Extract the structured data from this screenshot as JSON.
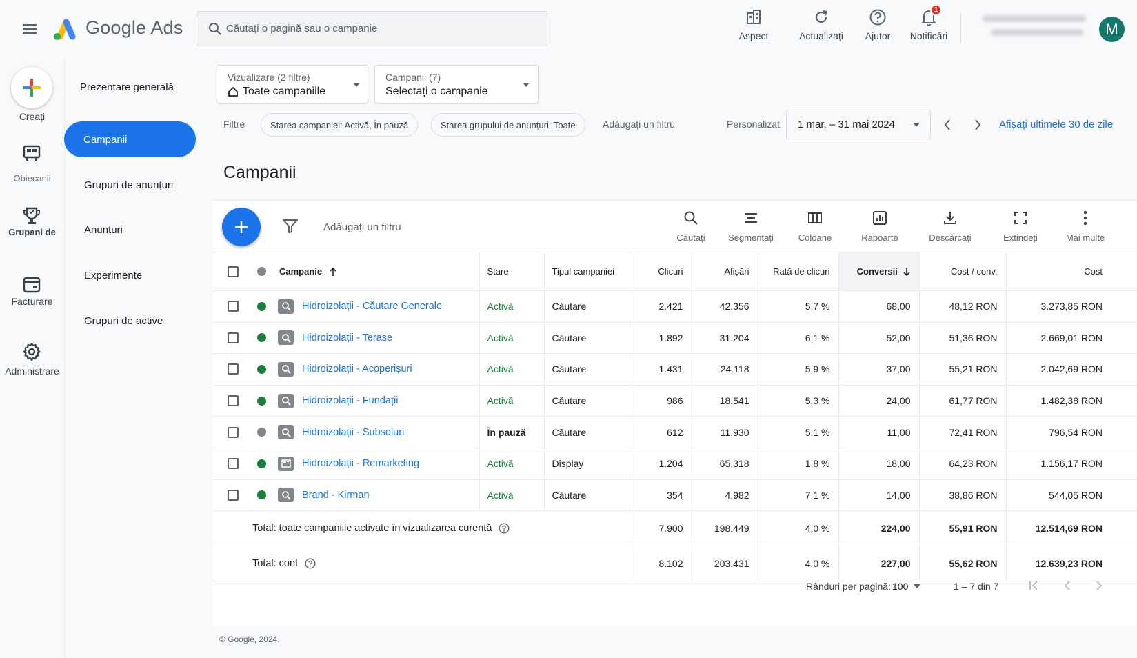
{
  "app": {
    "name": "Google Ads",
    "brand_colors": {
      "blue": "#4285F4",
      "yellow": "#FBBC04",
      "green": "#34A853",
      "red": "#EA4335"
    }
  },
  "search": {
    "placeholder": "Căutați o pagină sau o campanie"
  },
  "topbar": {
    "aspect": "Aspect",
    "refresh": "Actualizați",
    "help": "Ajutor",
    "notifications": "Notificări",
    "notifications_count": "1",
    "avatar_letter": "M"
  },
  "rail": {
    "create": "Creați",
    "goals": "Obiecanii",
    "groups": "Grupani de",
    "billing": "Facturare",
    "admin": "Administrare"
  },
  "nav": {
    "overview": "Prezentare generală",
    "campaigns": "Campanii",
    "ad_groups": "Grupuri de anunțuri",
    "ads": "Anunțuri",
    "experiments": "Experimente",
    "asset_groups": "Grupuri de active"
  },
  "view_dropdown": {
    "label": "Vizualizare (2 filtre)",
    "value": "Toate campaniile"
  },
  "campaign_dropdown": {
    "label": "Campanii (7)",
    "value": "Selectați o campanie"
  },
  "filters": {
    "label": "Filtre",
    "chip1": "Starea campaniei: Activă, În pauză",
    "chip2": "Starea grupului de anunțuri: Toate",
    "add": "Adăugați un filtru"
  },
  "date": {
    "preset": "Personalizat",
    "range": "1 mar. – 31 mai 2024",
    "last30": "Afișați ultimele 30 de zile"
  },
  "page_title": "Campanii",
  "table_toolbar": {
    "add_filter": "Adăugați un filtru",
    "search": "Căutați",
    "segment": "Segmentați",
    "columns": "Coloane",
    "reports": "Rapoarte",
    "download": "Descărcați",
    "expand": "Extindeți",
    "more": "Mai multe"
  },
  "table": {
    "headers": {
      "campaign": "Campanie",
      "status": "Stare",
      "type": "Tipul campaniei",
      "clicks": "Clicuri",
      "impressions": "Afișări",
      "ctr": "Rată de clicuri",
      "conversions": "Conversii",
      "cost_conv": "Cost / conv.",
      "cost": "Cost"
    },
    "rows": [
      {
        "name": "Hidroizolații - Căutare Generale",
        "status": "Activă",
        "type": "Căutare",
        "clicks": "2.421",
        "impressions": "42.356",
        "ctr": "5,7 %",
        "conversions": "68,00",
        "cost_conv": "48,12 RON",
        "cost": "3.273,85 RON"
      },
      {
        "name": "Hidroizolații - Terase",
        "status": "Activă",
        "type": "Căutare",
        "clicks": "1.892",
        "impressions": "31.204",
        "ctr": "6,1 %",
        "conversions": "52,00",
        "cost_conv": "51,36 RON",
        "cost": "2.669,01 RON"
      },
      {
        "name": "Hidroizolații - Acoperișuri",
        "status": "Activă",
        "type": "Căutare",
        "clicks": "1.431",
        "impressions": "24.118",
        "ctr": "5,9 %",
        "conversions": "37,00",
        "cost_conv": "55,21 RON",
        "cost": "2.042,69 RON"
      },
      {
        "name": "Hidroizolații - Fundații",
        "status": "Activă",
        "type": "Căutare",
        "clicks": "986",
        "impressions": "18.541",
        "ctr": "5,3 %",
        "conversions": "24,00",
        "cost_conv": "61,77 RON",
        "cost": "1.482,38 RON"
      },
      {
        "name": "Hidroizolații - Subsoluri",
        "status": "În pauză",
        "type": "Căutare",
        "clicks": "612",
        "impressions": "11.930",
        "ctr": "5,1 %",
        "conversions": "11,00",
        "cost_conv": "72,41 RON",
        "cost": "796,54 RON"
      },
      {
        "name": "Hidroizolații - Remarketing",
        "status": "Activă",
        "type": "Display",
        "clicks": "1.204",
        "impressions": "65.318",
        "ctr": "1,8 %",
        "conversions": "18,00",
        "cost_conv": "64,23 RON",
        "cost": "1.156,17 RON"
      },
      {
        "name": "Brand - Kirman",
        "status": "Activă",
        "type": "Căutare",
        "clicks": "354",
        "impressions": "4.982",
        "ctr": "7,1 %",
        "conversions": "14,00",
        "cost_conv": "38,86 RON",
        "cost": "544,05 RON"
      }
    ],
    "totals": [
      {
        "label": "Total: toate campaniile activate în vizualizarea curentă",
        "clicks": "7.900",
        "impressions": "198.449",
        "ctr": "4,0 %",
        "conversions": "224,00",
        "cost_conv": "55,91 RON",
        "cost": "12.514,69 RON"
      },
      {
        "label": "Total: cont",
        "clicks": "8.102",
        "impressions": "203.431",
        "ctr": "4,0 %",
        "conversions": "227,00",
        "cost_conv": "55,62 RON",
        "cost": "12.639,23 RON"
      }
    ]
  },
  "pagination": {
    "rows_label": "Rânduri per pagină:",
    "rows_value": "100",
    "range": "1 – 7 din 7"
  },
  "footer": "© Google, 2024."
}
